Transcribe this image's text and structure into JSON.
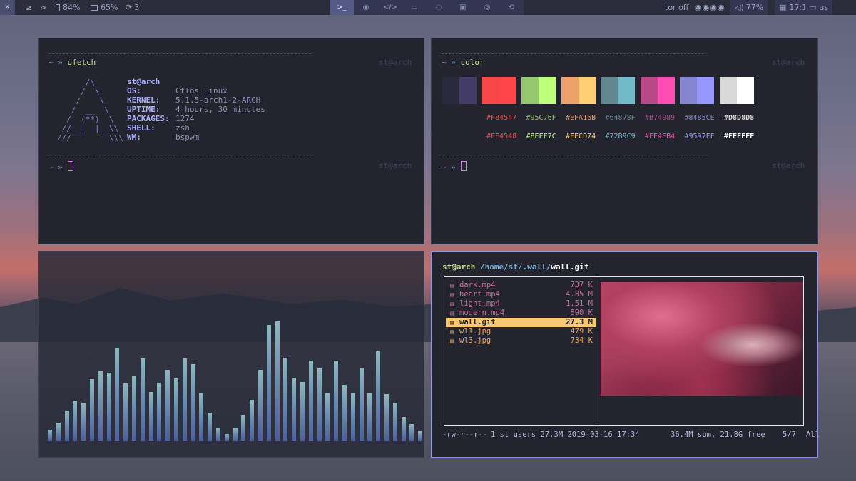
{
  "topbar": {
    "menu_glyph": "✕",
    "left_items": [
      {
        "icon": "terminal-prompt-icon",
        "label": "≥"
      },
      {
        "icon": "rss-icon",
        "label": "⋗"
      },
      {
        "icon": "battery-icon",
        "label": "84%"
      },
      {
        "icon": "memory-icon",
        "label": "65%"
      },
      {
        "icon": "refresh-icon",
        "label": "3"
      }
    ],
    "workspaces": [
      {
        "icon": "terminal-icon",
        "glyph": ">_",
        "active": true
      },
      {
        "icon": "globe-icon",
        "glyph": "◉",
        "active": false
      },
      {
        "icon": "code-icon",
        "glyph": "</>",
        "active": false
      },
      {
        "icon": "folder-icon",
        "glyph": "▭",
        "active": false
      },
      {
        "icon": "chat-icon",
        "glyph": "◌",
        "active": false
      },
      {
        "icon": "media-icon",
        "glyph": "▣",
        "active": false
      },
      {
        "icon": "eye-icon",
        "glyph": "◎",
        "active": false
      },
      {
        "icon": "steam-icon",
        "glyph": "⟲",
        "active": false
      }
    ],
    "tor": "tor off",
    "volume": "77%",
    "time": "17:19",
    "layout": "us"
  },
  "ufetch": {
    "prompt": "~ »",
    "command": "ufetch",
    "host": "st@arch",
    "logo": "      /\\\n     /  \\\n    /    \\\n   /  __  \\\n  /  (**)  \\\n //__|  |__\\\\\n///        \\\\\\",
    "user": "st@arch",
    "keys": [
      "OS:",
      "KERNEL:",
      "UPTIME:",
      "PACKAGES:",
      "SHELL:",
      "WM:"
    ],
    "values": [
      "Ctlos Linux",
      "5.1.5-arch1-2-ARCH",
      "4 hours, 30 minutes",
      "1274",
      "zsh",
      "bspwm"
    ],
    "prompt2": "~ »",
    "host2": "st@arch"
  },
  "color": {
    "prompt": "~ »",
    "command": "color",
    "host": "st@arch",
    "swatches": [
      [
        "#2a2a3c",
        "#443c66"
      ],
      [
        "#F84547",
        "#FF4548"
      ],
      [
        "#95C76F",
        "#BEFF7C"
      ],
      [
        "#EFA16B",
        "#FFCD74"
      ],
      [
        "#64878F",
        "#72B9C9"
      ],
      [
        "#B74989",
        "#FE4EB4"
      ],
      [
        "#8485CE",
        "#9597FF"
      ],
      [
        "#D8D8D8",
        "#FFFFFF"
      ]
    ],
    "row1": [
      "#F84547",
      "#95C76F",
      "#EFA16B",
      "#64878F",
      "#B74989",
      "#8485CE",
      "#D8D8D8"
    ],
    "row2": [
      "#FF4548",
      "#BEFF7C",
      "#FFCD74",
      "#72B9C9",
      "#FE4EB4",
      "#9597FF",
      "#FFFFFF"
    ],
    "prompt2": "~ »",
    "host2": "st@arch"
  },
  "visualizer": {
    "bars": [
      16,
      26,
      42,
      56,
      54,
      87,
      98,
      96,
      131,
      81,
      91,
      116,
      69,
      82,
      100,
      88,
      116,
      108,
      67,
      40,
      19,
      10,
      19,
      36,
      58,
      100,
      163,
      168,
      117,
      89,
      83,
      113,
      102,
      67,
      113,
      79,
      67,
      102,
      67,
      126,
      66,
      54,
      34,
      24,
      14
    ]
  },
  "fm": {
    "user": "st@arch",
    "path": "/home/st/.wall/",
    "file": "wall.gif",
    "rows": [
      {
        "name": "dark.mp4",
        "size": "737 K",
        "icon": "video-file-icon",
        "color": "#c46b98"
      },
      {
        "name": "heart.mp4",
        "size": "4.85 M",
        "icon": "video-file-icon",
        "color": "#c46b98"
      },
      {
        "name": "light.mp4",
        "size": "1.51 M",
        "icon": "video-file-icon",
        "color": "#c46b98"
      },
      {
        "name": "modern.mp4",
        "size": "890 K",
        "icon": "video-file-icon",
        "color": "#c46b98"
      },
      {
        "name": "wall.gif",
        "size": "27.3 M",
        "icon": "image-file-icon",
        "color": "#202030",
        "selected": true
      },
      {
        "name": "wl1.jpg",
        "size": "479 K",
        "icon": "image-file-icon",
        "color": "#e8a060"
      },
      {
        "name": "wl3.jpg",
        "size": "734 K",
        "icon": "image-file-icon",
        "color": "#e8a060"
      }
    ],
    "perms": "-rw-r--r--",
    "meta": "1 st users 27.3M 2019-03-16 17:34",
    "summary": "36.4M sum, 21.8G free",
    "pos": "5/7",
    "scroll": "All"
  }
}
